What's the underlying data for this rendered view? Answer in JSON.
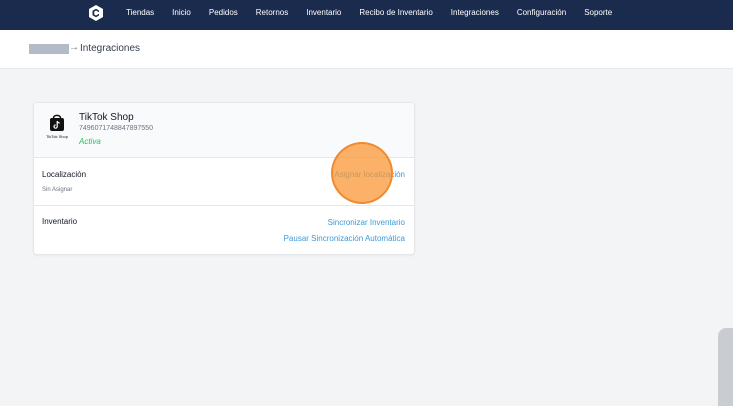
{
  "nav": {
    "items": [
      "Tiendas",
      "Inicio",
      "Pedidos",
      "Retornos",
      "Inventario",
      "Recibo de Inventario",
      "Integraciones",
      "Configuración",
      "Soporte"
    ]
  },
  "header": {
    "breadcrumb_arrow": "→",
    "title": "Integraciones"
  },
  "integration": {
    "logo_caption": "TikTok Shop",
    "name": "TikTok Shop",
    "id": "7496071748847897550",
    "status": "Activa",
    "status_color": "#22c55e"
  },
  "location": {
    "title": "Localización",
    "value": "Sin Asignar",
    "action": "Asignar localización"
  },
  "inventory": {
    "title": "Inventario",
    "sync_action": "Sincronizar Inventario",
    "pause_action": "Pausar Sincronización Automática"
  },
  "colors": {
    "nav_bg": "#1b2b4e",
    "link": "#3b9ad6",
    "page_bg": "#f3f4f6"
  }
}
